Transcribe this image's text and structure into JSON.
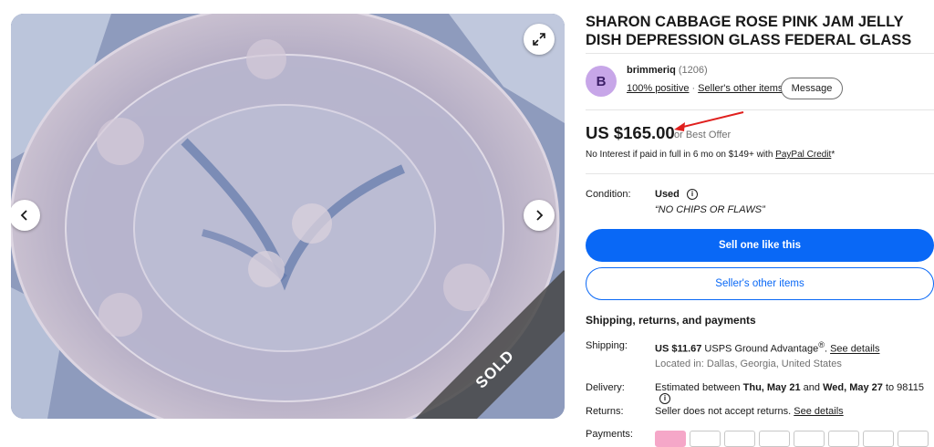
{
  "title": "SHARON CABBAGE ROSE PINK JAM JELLY DISH DEPRESSION GLASS FEDERAL GLASS",
  "gallery": {
    "ribbon": "SOLD",
    "prev_icon": "chevron-left-icon",
    "next_icon": "chevron-right-icon",
    "expand_icon": "expand-icon"
  },
  "seller": {
    "avatar_letter": "B",
    "name": "brimmeriq",
    "feedback_count": "(1206)",
    "positive": "100% positive",
    "other_items": "Seller's other items",
    "message": "Message"
  },
  "price": {
    "amount": "US $165.00",
    "best_offer": "or Best Offer",
    "no_interest": "No Interest if paid in full in 6 mo on $149+ with ",
    "paypal_credit": "PayPal Credit",
    "asterisk": "*"
  },
  "condition": {
    "label": "Condition:",
    "value": "Used",
    "note": "“NO CHIPS OR FLAWS”"
  },
  "buttons": {
    "sell": "Sell one like this",
    "other_items": "Seller's other items"
  },
  "shipping": {
    "section_title": "Shipping, returns, and payments",
    "shipping_label": "Shipping:",
    "shipping_price": "US $11.67",
    "shipping_service": " USPS Ground Advantage",
    "shipping_reg": "®",
    "shipping_dot": ". ",
    "see_details": "See details",
    "located": "Located in: Dallas, Georgia, United States",
    "delivery_label": "Delivery:",
    "delivery_prefix": "Estimated between ",
    "delivery_start": "Thu, May 21",
    "delivery_and": " and ",
    "delivery_end": "Wed, May 27",
    "delivery_suffix": " to 98115",
    "returns_label": "Returns:",
    "returns_text": "Seller does not accept returns. ",
    "returns_details": "See details",
    "payments_label": "Payments:"
  },
  "colors": {
    "primary_blue": "#0968f6",
    "annotation_red": "#e0201e"
  }
}
